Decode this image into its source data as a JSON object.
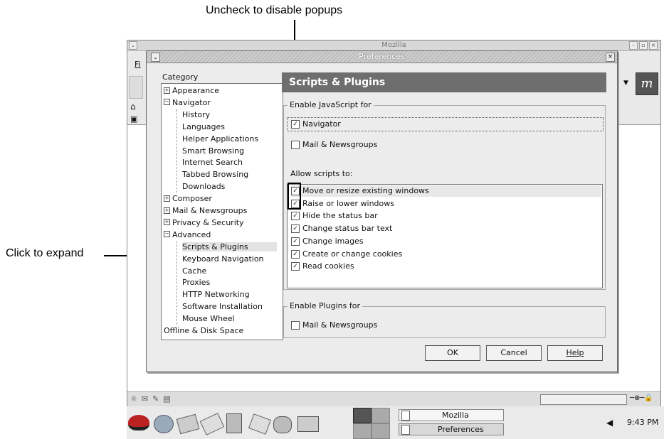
{
  "annotations": {
    "popups_callout": "Uncheck to disable popups",
    "expand_callout": "Click to expand"
  },
  "mozilla_window": {
    "title": "Mozilla",
    "menu_fragment": "Fi"
  },
  "dialog": {
    "title": "Preferences",
    "category_label": "Category",
    "tree": [
      {
        "label": "Appearance",
        "level": 0,
        "expander": "+"
      },
      {
        "label": "Navigator",
        "level": 0,
        "expander": "−"
      },
      {
        "label": "History",
        "level": 1
      },
      {
        "label": "Languages",
        "level": 1
      },
      {
        "label": "Helper Applications",
        "level": 1
      },
      {
        "label": "Smart Browsing",
        "level": 1
      },
      {
        "label": "Internet Search",
        "level": 1
      },
      {
        "label": "Tabbed Browsing",
        "level": 1
      },
      {
        "label": "Downloads",
        "level": 1
      },
      {
        "label": "Composer",
        "level": 0,
        "expander": "+"
      },
      {
        "label": "Mail & Newsgroups",
        "level": 0,
        "expander": "+"
      },
      {
        "label": "Privacy & Security",
        "level": 0,
        "expander": "+"
      },
      {
        "label": "Advanced",
        "level": 0,
        "expander": "−"
      },
      {
        "label": "Scripts & Plugins",
        "level": 1,
        "selected": true
      },
      {
        "label": "Keyboard Navigation",
        "level": 1
      },
      {
        "label": "Cache",
        "level": 1
      },
      {
        "label": "Proxies",
        "level": 1
      },
      {
        "label": "HTTP Networking",
        "level": 1
      },
      {
        "label": "Software Installation",
        "level": 1
      },
      {
        "label": "Mouse Wheel",
        "level": 1
      },
      {
        "label": "Offline & Disk Space",
        "level": 0
      }
    ],
    "panel_title": "Scripts & Plugins",
    "enable_js_label": "Enable JavaScript for",
    "js_navigator": {
      "label": "Navigator",
      "checked": true
    },
    "js_mail": {
      "label": "Mail & Newsgroups",
      "checked": false
    },
    "allow_scripts_label": "Allow scripts to:",
    "allow_scripts": [
      {
        "label": "Move or resize existing windows",
        "checked": true
      },
      {
        "label": "Raise or lower windows",
        "checked": true
      },
      {
        "label": "Hide the status bar",
        "checked": true
      },
      {
        "label": "Change status bar text",
        "checked": true
      },
      {
        "label": "Change images",
        "checked": true
      },
      {
        "label": "Create or change cookies",
        "checked": true
      },
      {
        "label": "Read cookies",
        "checked": true
      }
    ],
    "enable_plugins_label": "Enable Plugins for",
    "plugins_mail": {
      "label": "Mail & Newsgroups",
      "checked": false
    },
    "buttons": {
      "ok": "OK",
      "cancel": "Cancel",
      "help": "Help"
    }
  },
  "taskbar": {
    "tasks": [
      "Mozilla",
      "Preferences"
    ],
    "clock": "9:43 PM"
  },
  "check_glyph": "✓"
}
